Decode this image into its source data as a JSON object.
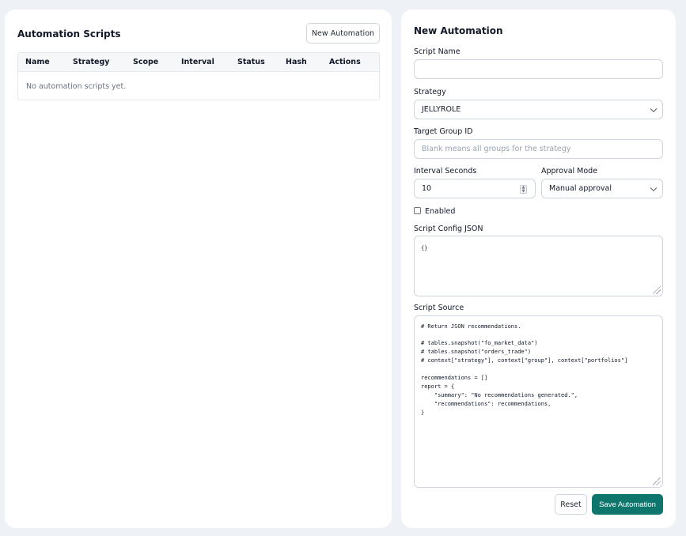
{
  "scripts_panel": {
    "title": "Automation Scripts",
    "new_button": "New Automation",
    "columns": [
      "Name",
      "Strategy",
      "Scope",
      "Interval",
      "Status",
      "Hash",
      "Actions"
    ],
    "empty_message": "No automation scripts yet."
  },
  "form": {
    "title": "New Automation",
    "script_name": {
      "label": "Script Name",
      "value": ""
    },
    "strategy": {
      "label": "Strategy",
      "selected": "JELLYROLE"
    },
    "target_group": {
      "label": "Target Group ID",
      "placeholder": "Blank means all groups for the strategy",
      "value": ""
    },
    "interval": {
      "label": "Interval Seconds",
      "value": "10"
    },
    "approval_mode": {
      "label": "Approval Mode",
      "selected": "Manual approval"
    },
    "enabled": {
      "label": "Enabled",
      "checked": false
    },
    "config_json": {
      "label": "Script Config JSON",
      "value": "{}"
    },
    "source": {
      "label": "Script Source",
      "lines": [
        "# Return JSON recommendations.",
        "",
        "# tables.snapshot(\"fo_market_data\")",
        "# tables.snapshot(\"orders_trade\")",
        "# context[\"strategy\"], context[\"group\"], context[\"portfolios\"]",
        "",
        "recommendations = []",
        "report = {",
        "    \"summary\": \"No recommendations generated.\",",
        "    \"recommendations\": recommendations,",
        "}"
      ]
    },
    "reset_button": "Reset",
    "save_button": "Save Automation"
  },
  "colors": {
    "accent": "#0f766e",
    "background": "#eef1f5",
    "panel": "#ffffff"
  }
}
